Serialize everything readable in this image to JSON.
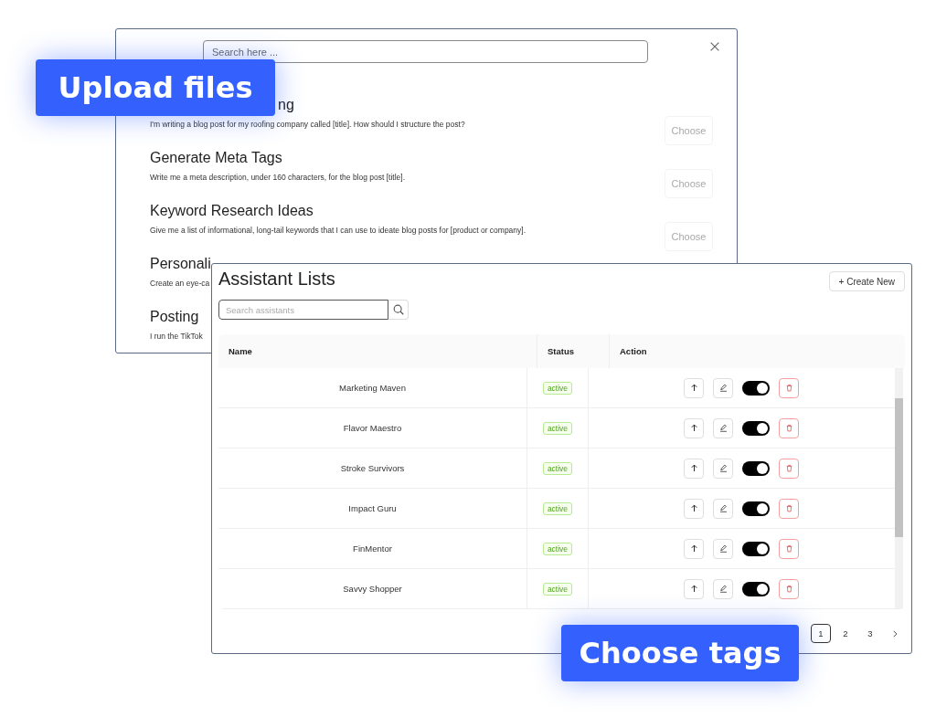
{
  "prompt_dialog": {
    "search": {
      "placeholder": "Search here ..."
    },
    "prompts": [
      {
        "kind": "covered",
        "title": "ng",
        "description": "I'm writing a blog post for my roofing company called [title]. How should I structure the post?",
        "action": "Choose"
      },
      {
        "kind": "plain",
        "title": "Generate Meta Tags",
        "description": "Write me a meta description, under 160 characters, for the blog post [title].",
        "action": "Choose"
      },
      {
        "kind": "plain",
        "title": "Keyword Research Ideas",
        "description": "Give me a list of informational, long-tail keywords that I can use to ideate blog posts for [product or company].",
        "action": "Choose"
      },
      {
        "kind": "plain",
        "title": "Personali",
        "description": "Create an eye-ca"
      },
      {
        "kind": "plain",
        "title": "Posting",
        "description": "I run the TikTok"
      }
    ]
  },
  "assistant_lists": {
    "title": "Assistant Lists",
    "create_button": "+ Create New",
    "search": {
      "placeholder": "Search assistants"
    },
    "columns": [
      "Name",
      "Status",
      "Action"
    ],
    "rows": [
      {
        "name": "Marketing Maven",
        "status": "active",
        "enabled": true
      },
      {
        "name": "Flavor Maestro",
        "status": "active",
        "enabled": true
      },
      {
        "name": "Stroke Survivors",
        "status": "active",
        "enabled": true
      },
      {
        "name": "Impact Guru",
        "status": "active",
        "enabled": true
      },
      {
        "name": "FinMentor",
        "status": "active",
        "enabled": true
      },
      {
        "name": "Savvy Shopper",
        "status": "active",
        "enabled": true
      }
    ],
    "pages": [
      {
        "label": "1",
        "selected": true
      },
      {
        "label": "2",
        "selected": false
      },
      {
        "label": "3",
        "selected": false
      }
    ]
  },
  "callouts": [
    "Upload files",
    "Choose tags"
  ]
}
